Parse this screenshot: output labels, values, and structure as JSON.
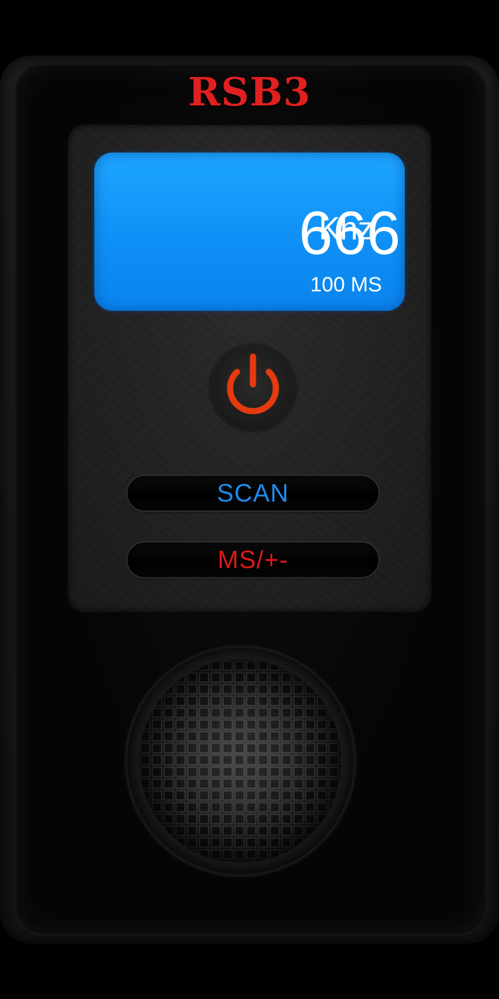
{
  "app": {
    "brand": "RSB3"
  },
  "display": {
    "frequency": "666",
    "unit": "Khz",
    "step": "100 MS",
    "background_color": "#0f90f6"
  },
  "controls": {
    "power_icon": "power-icon",
    "power_color": "#e53a0e",
    "scan_label": "SCAN",
    "scan_color": "#1e8cf0",
    "ms_label": "MS/+-",
    "ms_color": "#e01818"
  },
  "speaker": {
    "icon": "speaker-grille"
  },
  "colors": {
    "brand": "#e02020",
    "background": "#000000"
  }
}
